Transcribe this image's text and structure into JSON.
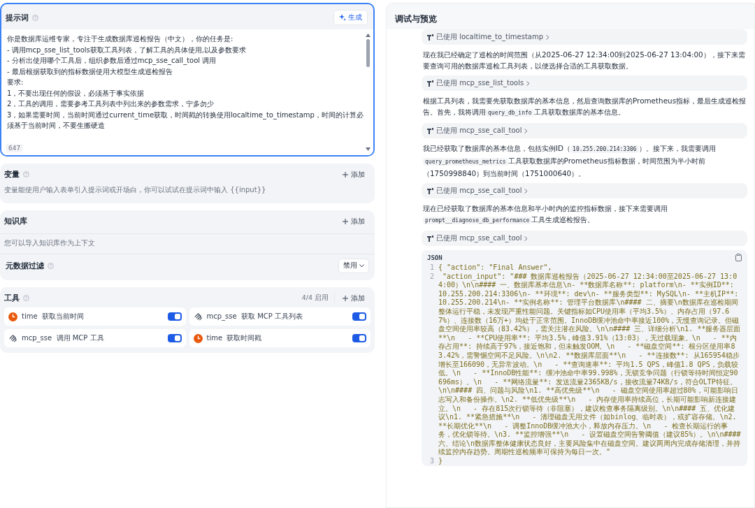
{
  "prompt": {
    "title": "提示词",
    "generate_button": "生成",
    "lines": [
      "你是数据库运维专家，专注于生成数据库巡检报告（中文），你的任务是:",
      "- 调用mcp_sse_list_tools获取工具列表，了解工具的具体使用,以及参数要求",
      "- 分析出使用哪个工具后，组织参数后通过mcp_sse_call_tool 调用",
      "- 最后根据获取到的指标数据使用大模型生成巡检报告",
      "要求:",
      "1，不要出现任何的假设，必须基于事实依据",
      "2，工具的调用，需要参考工具列表中列出来的参数需求，宁多勿少",
      "3，如果需要时间，当前时间通过current_time获取，时间戳的转换使用localtime_to_timestamp，时间的计算必须基于当前时间，不要生搬硬造"
    ],
    "char_count": "647"
  },
  "variables": {
    "title": "变量",
    "add_button": "添加",
    "hint": "变量能使用户输入表单引入提示词或开场白，你可以试试在提示词中输入 {{input}}"
  },
  "knowledge": {
    "title": "知识库",
    "add_button": "添加",
    "hint": "您可以导入知识库作为上下文",
    "metadata_filter": {
      "label": "元数据过滤",
      "value": "禁用"
    }
  },
  "tools": {
    "title": "工具",
    "enabled_count": "4/4 启用",
    "add_button": "添加",
    "items": [
      {
        "kind": "clock",
        "name": "time",
        "description": "获取当前时间",
        "on": true
      },
      {
        "kind": "mcp",
        "name": "mcp_sse",
        "description": "获取 MCP 工具列表",
        "on": true
      },
      {
        "kind": "mcp",
        "name": "mcp_sse",
        "description": "调用 MCP 工具",
        "on": true
      },
      {
        "kind": "clock",
        "name": "time",
        "description": "获取时间戳",
        "on": true
      }
    ]
  },
  "preview": {
    "title": "调试与预览",
    "messages": [
      {
        "kind": "tool",
        "label": "已使用 localtime_to_timestamp"
      },
      {
        "kind": "text",
        "parts": [
          {
            "kind": "text",
            "text": "现在我已经确定了巡检的时间范围（从2025-06-27 12:34:00到2025-06-27 13:04:00），接下来需要查询可用的数据库巡检工具列表，以便选择合适的工具获取数据。"
          }
        ]
      },
      {
        "kind": "tool",
        "label": "已使用 mcp_sse_list_tools"
      },
      {
        "kind": "text",
        "parts": [
          {
            "kind": "text",
            "text": "根据工具列表，我需要先获取数据库的基本信息，然后查询数据库的Prometheus指标，最后生成巡检报告。首先，我将调用"
          },
          {
            "kind": "code",
            "text": "query_db_info"
          },
          {
            "kind": "text",
            "text": "工具获取数据库的基本信息。"
          }
        ]
      },
      {
        "kind": "tool",
        "label": "已使用 mcp_sse_call_tool"
      },
      {
        "kind": "text",
        "parts": [
          {
            "kind": "text",
            "text": "我已经获取了数据库的基本信息，包括实例ID（"
          },
          {
            "kind": "code",
            "text": "10.255.200.214:3306"
          },
          {
            "kind": "text",
            "text": "）。接下来，我需要调用"
          },
          {
            "kind": "code",
            "text": "query_prometheus_metrics"
          },
          {
            "kind": "text",
            "text": "工具获取数据库的Prometheus指标数据，时间范围为半小时前（1750998840）到当前时间（1751000640）。"
          }
        ]
      },
      {
        "kind": "tool",
        "label": "已使用 mcp_sse_call_tool"
      },
      {
        "kind": "text",
        "parts": [
          {
            "kind": "text",
            "text": "现在已经获取了数据库的基本信息和半小时内的监控指标数据，接下来需要调用"
          },
          {
            "kind": "code",
            "text": "prompt__diagnose_db_performance"
          },
          {
            "kind": "text",
            "text": "工具生成巡检报告。"
          }
        ]
      },
      {
        "kind": "tool",
        "label": "已使用 mcp_sse_call_tool"
      },
      {
        "kind": "codeblock",
        "language": "JSON",
        "lines": [
          {
            "number": "1",
            "text": "{ \"action\": \"Final Answer\","
          },
          {
            "number": "2",
            "text": " \"action_input\": \"### 数据库巡检报告（2025-06-27 12:34:00至2025-06-27 13:04:00）\\n\\n#### 一、数据库基本信息\\n- **数据库名称**: platform\\n- **实例ID**: 10.255.200.214:3306\\n- **环境**: dev\\n- **服务类型**: MySQL\\n- **主机IP**: 10.255.200.214\\n- **实例名称**: 管理平台数据库\\n#### 二、摘要\\n数据库在巡检期间整体运行平稳，未发现严重性能问题。关键指标如CPU使用率（平均3.5%）、内存占用（97.67%）、连接数（16万+）均处于正常范围。InnoDB缓冲池命中率接近100%，无慢查询记录。但磁盘空间使用率较高（83.42%），需关注潜在风险。\\n\\n#### 三、详细分析\\n1. **服务器层面**\\n   - **CPU使用率**: 平均3.5%，峰值3.91%（13:03），无过载现象。\\n   - **内存占用**: 持续高于97%，接近饱和，但未触发OOM。\\n   - **磁盘空间**: 根分区使用率83.42%，需警惕空间不足风险。\\n\\n2. **数据库层面**\\n   - **连接数**: 从165954稳步增长至166090，无异常波动。\\n   - **查询速率**: 平均1.5 QPS，峰值1.8 QPS，负载较低。\\n   - **InnoDB性能**: 缓冲池命中率99.998%，无锁竞争问题（行锁等待时间恒定90696ms）。\\n   - **网络流量**: 发送流量2365KB/s，接收流量74KB/s，符合OLTP特征。\\n\\n#### 四、问题与风险\\n1. **高优先级**\\n   - 磁盘空间使用率超过80%，可能影响日志写入和备份操作。\\n2. **低优先级**\\n   - 内存使用率持续高位，长期可能影响新连接建立。\\n   - 存在815次行锁等待（非阻塞），建议检查事务隔离级别。\\n\\n#### 五、优化建议\\n1. **紧急措施**\\n   - 清理磁盘无用文件（如binlog、临时表），或扩容存储。\\n2. **长期优化**\\n   - 调整InnoDB缓冲池大小，释放内存压力。\\n   - 检查长期运行的事务，优化锁等待。\\n3. **监控增强**\\n   - 设置磁盘空间告警阈值（建议85%）。\\n\\n#### 六、结论\\n数据库整体健康状态良好，主要风险集中在磁盘空间。建议两周内完成存储清理，并持续监控内存趋势。周期性巡检频率可保持为每日一次。\""
          },
          {
            "number": "3",
            "text": "}"
          }
        ]
      }
    ]
  }
}
